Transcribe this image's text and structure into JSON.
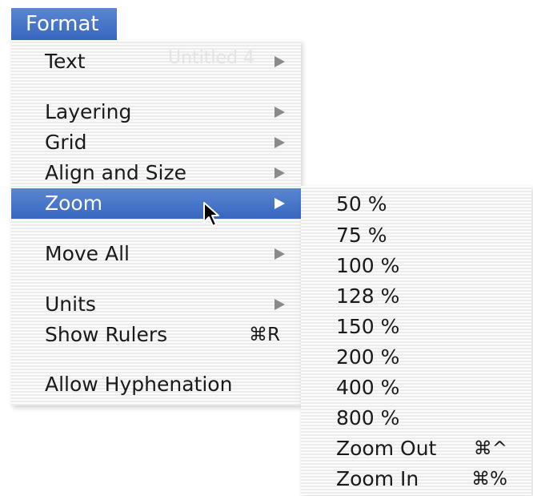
{
  "menubar": {
    "title": "Format"
  },
  "format_menu": {
    "ghost_text": "Untitled 4",
    "items": [
      {
        "label": "Text",
        "has_submenu": true
      },
      {
        "label": "Layering",
        "has_submenu": true
      },
      {
        "label": "Grid",
        "has_submenu": true
      },
      {
        "label": "Align and Size",
        "has_submenu": true
      },
      {
        "label": "Zoom",
        "has_submenu": true,
        "highlighted": true
      },
      {
        "label": "Move All",
        "has_submenu": true
      },
      {
        "label": "Units",
        "has_submenu": true
      },
      {
        "label": "Show Rulers",
        "shortcut": "⌘R"
      },
      {
        "label": "Allow Hyphenation"
      }
    ]
  },
  "zoom_submenu": {
    "items": [
      {
        "label": "50 %"
      },
      {
        "label": "75 %"
      },
      {
        "label": "100 %"
      },
      {
        "label": "128 %"
      },
      {
        "label": "150 %"
      },
      {
        "label": "200 %"
      },
      {
        "label": "400 %"
      },
      {
        "label": "800 %"
      },
      {
        "label": "Zoom Out",
        "shortcut": "⌘^"
      },
      {
        "label": "Zoom In",
        "shortcut": "⌘%"
      }
    ]
  },
  "colors": {
    "highlight": "#3f6fc4",
    "menu_background": "#f7f7f7",
    "text": "#1a1a1a"
  }
}
